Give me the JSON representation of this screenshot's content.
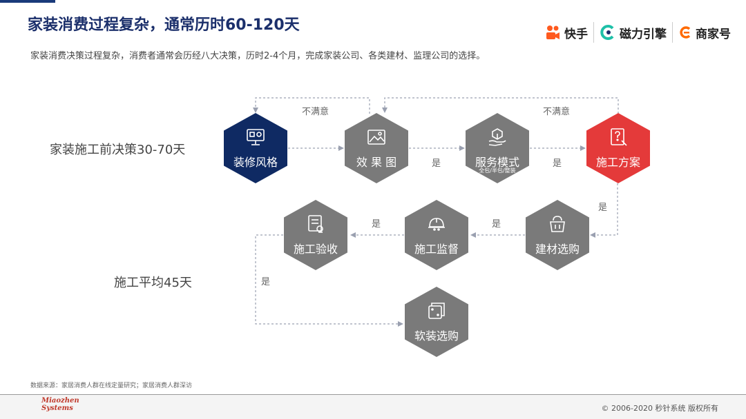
{
  "page": {
    "title": "家装消费过程复杂，通常历时60-120天",
    "subtitle": "家装消费决策过程复杂，消费者通常会历经八大决策，历时2-4个月，完成家装公司、各类建材、监理公司的选择。"
  },
  "logos": [
    {
      "name": "快手",
      "color": "#ff5a1f"
    },
    {
      "name": "磁力引擎",
      "color": "#1ec0a8"
    },
    {
      "name": "商家号",
      "color": "#ff6a00"
    }
  ],
  "side_labels": {
    "pre": "家装施工前决策30-70天",
    "during": "施工平均45天"
  },
  "colors": {
    "navy": "#0f2a63",
    "gray": "#7a7a7a",
    "red": "#e43a3a",
    "line": "#9aa0b0"
  },
  "steps": [
    {
      "label": "装修风格",
      "icon": "monitor-icon",
      "color": "#0f2a63"
    },
    {
      "label": "效 果 图",
      "icon": "image-icon",
      "color": "#7a7a7a"
    },
    {
      "label": "服务模式",
      "sub": "全包/半包/整装",
      "icon": "hand-box-icon",
      "color": "#7a7a7a"
    },
    {
      "label": "施工方案",
      "icon": "plan-doc-icon",
      "color": "#e43a3a"
    },
    {
      "label": "建材选购",
      "icon": "bag-icon",
      "color": "#7a7a7a"
    },
    {
      "label": "施工监督",
      "icon": "helmet-icon",
      "color": "#7a7a7a"
    },
    {
      "label": "施工验收",
      "icon": "checklist-icon",
      "color": "#7a7a7a"
    },
    {
      "label": "软装选购",
      "icon": "furniture-icon",
      "color": "#7a7a7a"
    }
  ],
  "edges": {
    "unsatisfied_1": "不满意",
    "unsatisfied_2": "不满意",
    "yes_1": "是",
    "yes_2": "是",
    "yes_3": "是",
    "yes_4": "是",
    "yes_5": "是",
    "yes_6": "是"
  },
  "footer": {
    "source": "数据来源：家居消费人群在线定量研究；家居消费人群深访",
    "brand_line1": "Miaozhen",
    "brand_line2": "Systems",
    "copyright": "© 2006-2020 秒针系统 版权所有"
  }
}
